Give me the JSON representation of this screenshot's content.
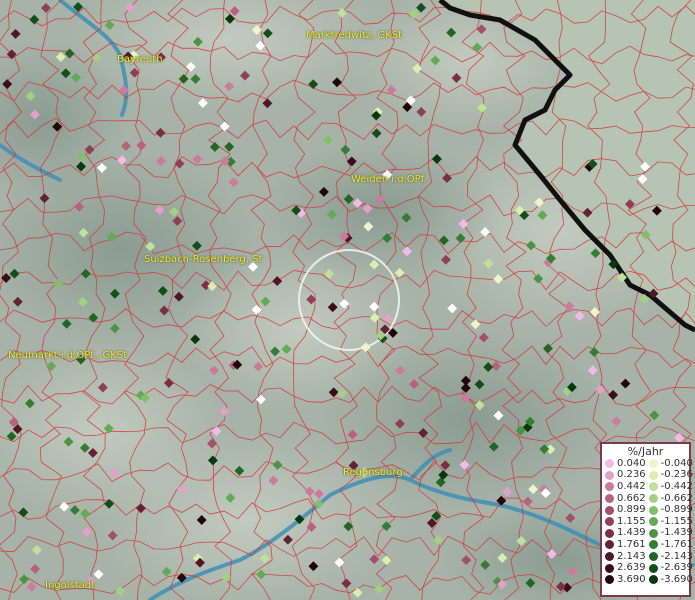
{
  "map": {
    "cities": [
      {
        "name": "Bayreuth"
      },
      {
        "name": "Marktredwitz, GKSt"
      },
      {
        "name": "Weiden i.d.OPf."
      },
      {
        "name": "Sulzbach-Rosenberg, St"
      },
      {
        "name": "Neumarkt i.d.OPf., GKSt"
      },
      {
        "name": "Regensburg"
      },
      {
        "name": "Ingolstadt"
      }
    ]
  },
  "legend": {
    "title": "%/Jahr",
    "positive": [
      "0.040",
      "0.236",
      "0.442",
      "0.662",
      "0.899",
      "1.155",
      "1.439",
      "1.761",
      "2.143",
      "2.639",
      "3.690"
    ],
    "negative": [
      "-0.040",
      "-0.236",
      "-0.442",
      "-0.662",
      "-0.899",
      "-1.155",
      "-1.439",
      "-1.761",
      "-2.143",
      "-2.639",
      "-3.690"
    ],
    "positive_colors": [
      "#f5b8ea",
      "#e4a0c8",
      "#cc7a9e",
      "#b8627f",
      "#a4506a",
      "#8f3f56",
      "#7b2f45",
      "#652236",
      "#4f1727",
      "#3a0d1a",
      "#23050c"
    ],
    "negative_colors": [
      "#eef5cc",
      "#d9efaf",
      "#bfe29a",
      "#a2d184",
      "#82bf6c",
      "#62aa55",
      "#4a9442",
      "#357d32",
      "#236624",
      "#134f18",
      "#063a0d"
    ]
  }
}
